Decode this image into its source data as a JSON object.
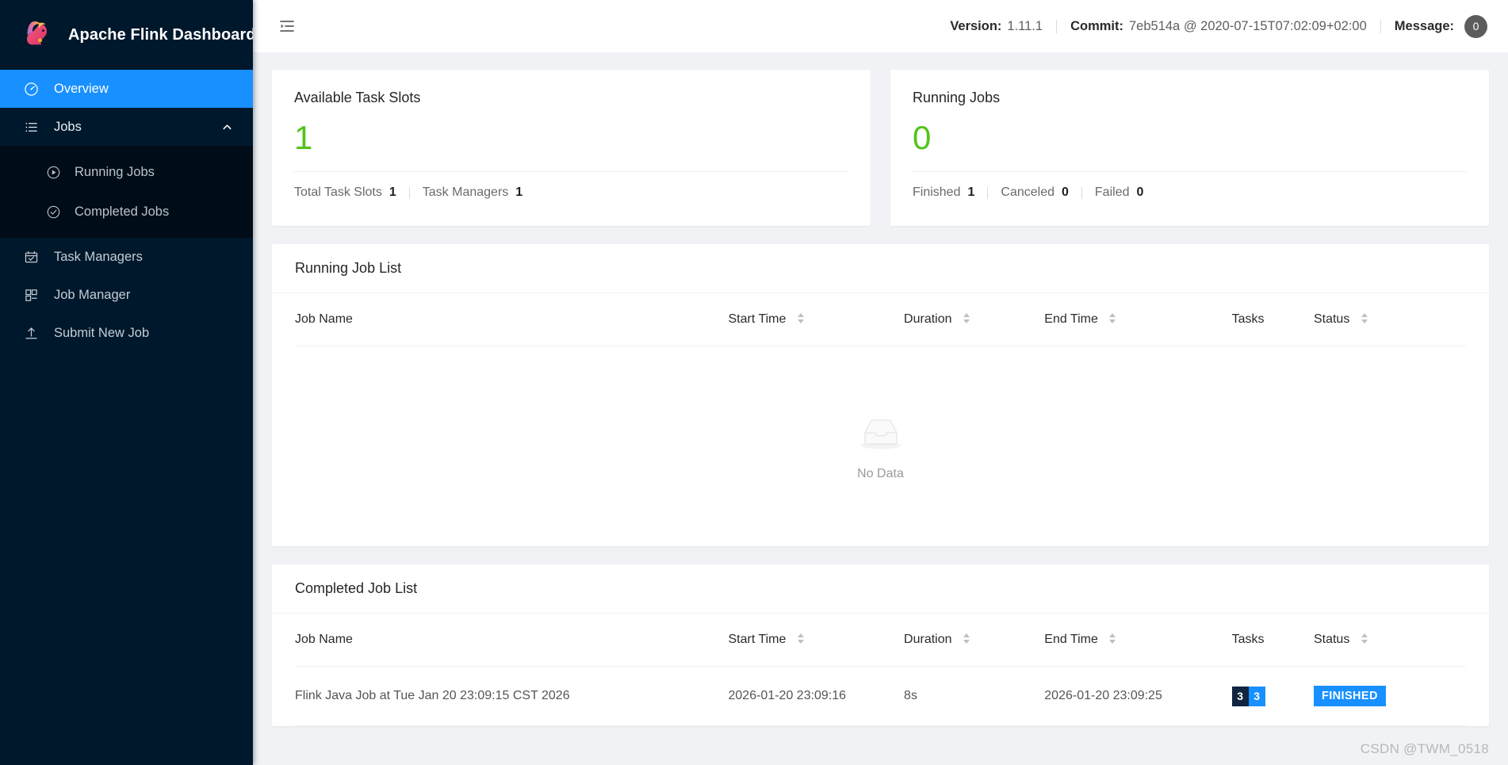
{
  "brand": {
    "title": "Apache Flink Dashboard",
    "logo_icon": "flink-squirrel-logo"
  },
  "sidebar": {
    "items": [
      {
        "label": "Overview",
        "icon": "dashboard-icon",
        "active": true
      },
      {
        "label": "Jobs",
        "icon": "unordered-list-icon",
        "expanded": true
      },
      {
        "label": "Running Jobs",
        "icon": "play-circle-icon"
      },
      {
        "label": "Completed Jobs",
        "icon": "check-circle-icon"
      },
      {
        "label": "Task Managers",
        "icon": "calendar-check-icon"
      },
      {
        "label": "Job Manager",
        "icon": "cluster-icon"
      },
      {
        "label": "Submit New Job",
        "icon": "upload-icon"
      }
    ]
  },
  "topbar": {
    "fold_icon": "menu-fold-icon",
    "version_label": "Version:",
    "version_value": "1.11.1",
    "commit_label": "Commit:",
    "commit_value": "7eb514a @ 2020-07-15T07:02:09+02:00",
    "message_label": "Message:",
    "message_count": "0"
  },
  "stats": {
    "task_slots": {
      "title": "Available Task Slots",
      "value": "1",
      "value_color": "#52c41a",
      "footer": [
        {
          "label": "Total Task Slots",
          "value": "1"
        },
        {
          "label": "Task Managers",
          "value": "1"
        }
      ]
    },
    "running_jobs": {
      "title": "Running Jobs",
      "value": "0",
      "value_color": "#52c41a",
      "footer": [
        {
          "label": "Finished",
          "value": "1"
        },
        {
          "label": "Canceled",
          "value": "0"
        },
        {
          "label": "Failed",
          "value": "0"
        }
      ]
    }
  },
  "running_job_list": {
    "title": "Running Job List",
    "columns": [
      "Job Name",
      "Start Time",
      "Duration",
      "End Time",
      "Tasks",
      "Status"
    ],
    "rows": [],
    "empty_text": "No Data",
    "empty_icon": "empty-inbox-icon"
  },
  "completed_job_list": {
    "title": "Completed Job List",
    "columns": [
      "Job Name",
      "Start Time",
      "Duration",
      "End Time",
      "Tasks",
      "Status"
    ],
    "rows": [
      {
        "job_name": "Flink Java Job at Tue Jan 20 23:09:15 CST 2026",
        "start_time": "2026-01-20 23:09:16",
        "duration": "8s",
        "end_time": "2026-01-20 23:09:25",
        "tasks": {
          "dark": "3",
          "blue": "3"
        },
        "status": "FINISHED"
      }
    ]
  },
  "watermark": "CSDN @TWM_0518",
  "colors": {
    "accent": "#1890ff",
    "sidebar": "#00182c",
    "submenu": "#000c17",
    "success": "#52c41a",
    "task_dark": "#11253f"
  }
}
